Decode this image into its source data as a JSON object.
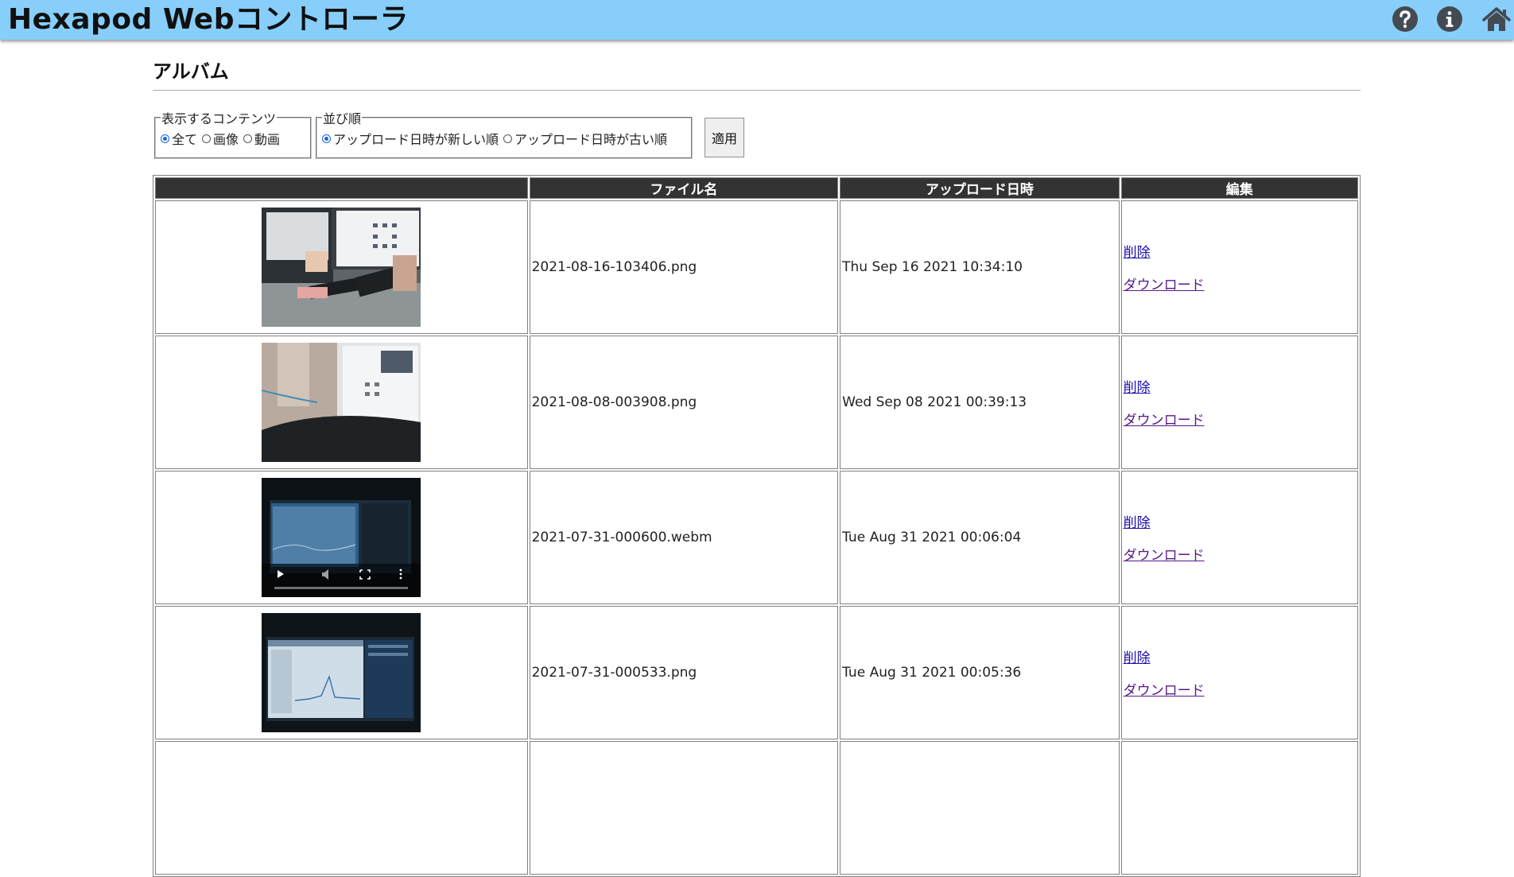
{
  "app": {
    "title": "Hexapod Webコントローラ"
  },
  "header_icons": [
    "question-circle-icon",
    "info-circle-icon",
    "home-icon"
  ],
  "page": {
    "heading": "アルバム"
  },
  "filter": {
    "content_legend": "表示するコンテンツ",
    "content_options": [
      {
        "label": "全て",
        "selected": true
      },
      {
        "label": "画像",
        "selected": false
      },
      {
        "label": "動画",
        "selected": false
      }
    ],
    "order_legend": "並び順",
    "order_options": [
      {
        "label": "アップロード日時が新しい順",
        "selected": true
      },
      {
        "label": "アップロード日時が古い順",
        "selected": false
      }
    ],
    "apply_label": "適用"
  },
  "table": {
    "headers": [
      "",
      "ファイル名",
      "アップロード日時",
      "編集"
    ],
    "rows": [
      {
        "filename": "2021-08-16-103406.png",
        "uploaded": "Thu Sep 16 2021 10:34:10",
        "delete_label": "削除",
        "download_label": "ダウンロード"
      },
      {
        "filename": "2021-08-08-003908.png",
        "uploaded": "Wed Sep 08 2021 00:39:13",
        "delete_label": "削除",
        "download_label": "ダウンロード"
      },
      {
        "filename": "2021-07-31-000600.webm",
        "uploaded": "Tue Aug 31 2021 00:06:04",
        "delete_label": "削除",
        "download_label": "ダウンロード"
      },
      {
        "filename": "2021-07-31-000533.png",
        "uploaded": "Tue Aug 31 2021 00:05:36",
        "delete_label": "削除",
        "download_label": "ダウンロード"
      }
    ]
  },
  "colors": {
    "header_bar": "#87cefa",
    "table_header": "#333333",
    "link": "#1a0dab",
    "visited_link": "#551a8b"
  }
}
